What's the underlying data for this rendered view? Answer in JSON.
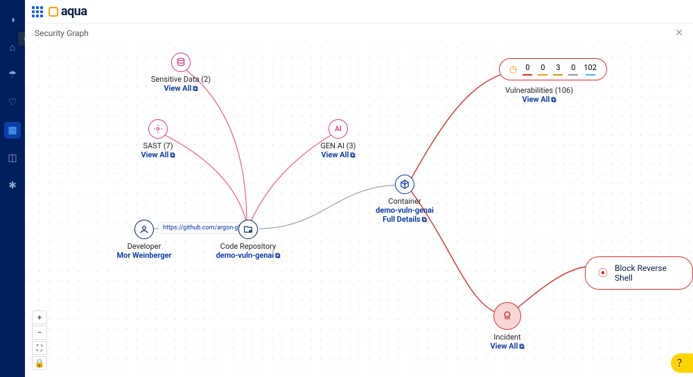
{
  "brand": {
    "name": "aqua"
  },
  "breadcrumb": "Security Graph",
  "sidebar": {
    "items": [
      {
        "name": "dashboard",
        "glyph": "◑"
      },
      {
        "name": "home",
        "glyph": "⌂"
      },
      {
        "name": "umbrella",
        "glyph": "☂"
      },
      {
        "name": "shield",
        "glyph": "♡"
      },
      {
        "name": "graph",
        "glyph": "▦",
        "active": true
      },
      {
        "name": "workloads",
        "glyph": "◫"
      },
      {
        "name": "settings",
        "glyph": "✱"
      }
    ]
  },
  "nodes": {
    "developer": {
      "title": "Developer",
      "value": "Mor Weinberger",
      "icon": "person"
    },
    "repo": {
      "title": "Code Repository",
      "value": "demo-vuln-genai",
      "icon": "repo",
      "url_chip": "https://github.com/argon-gh-de…"
    },
    "sensitive": {
      "title": "Sensitive Data (2)",
      "link": "View All",
      "icon": "db"
    },
    "sast": {
      "title": "SAST (7)",
      "link": "View All",
      "icon": "target"
    },
    "genai": {
      "title": "GEN AI (3)",
      "link": "View All",
      "icon_text": "AI"
    },
    "container": {
      "title": "Container",
      "value": "demo-vuln-genai",
      "link": "Full Details",
      "icon": "cube"
    },
    "vulns": {
      "title": "Vulnerabilities (106)",
      "link": "View All",
      "counts": {
        "c0": "0",
        "c1": "0",
        "c2": "3",
        "c3": "0",
        "c4": "102"
      }
    },
    "incident": {
      "title": "Incident",
      "link": "View All",
      "icon": "incident"
    },
    "block": {
      "label": "Block Reverse Shell"
    }
  },
  "zoom": {
    "fit_title": "Fit",
    "lock_title": "Lock"
  }
}
